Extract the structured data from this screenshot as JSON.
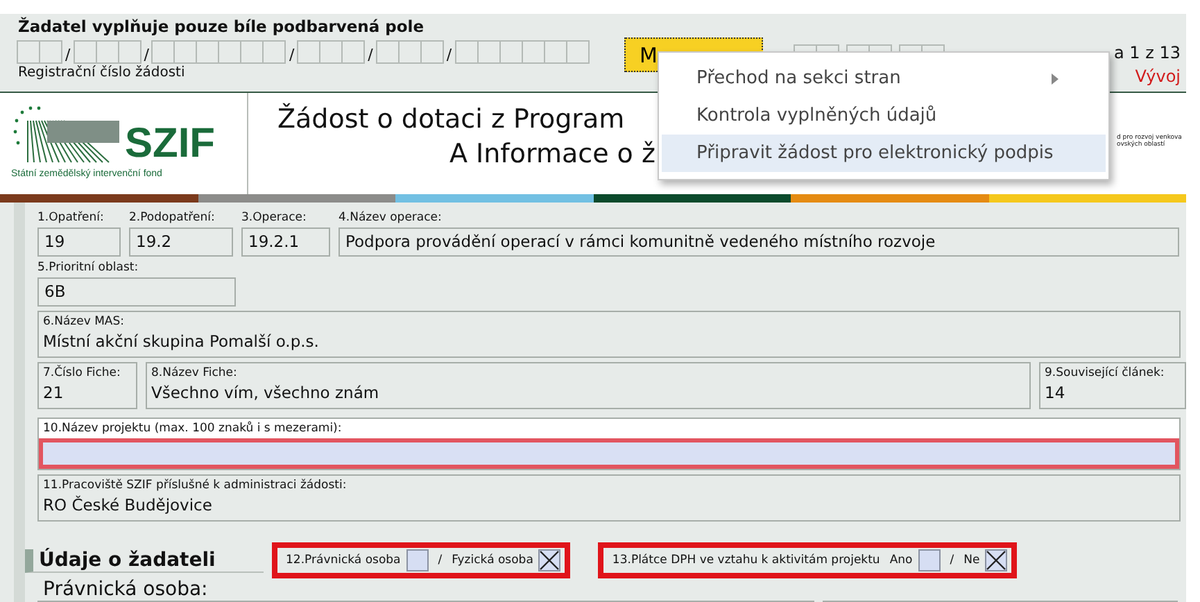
{
  "header": {
    "instruction": "Žadatel vyplňuje pouze bíle podbarvená pole",
    "registration_separators": [
      "/",
      "/",
      "/",
      "/",
      "/"
    ],
    "registration_label": "Registrační číslo žádosti",
    "menu_button": "M",
    "page_label": "a 1 z 13",
    "mode": "Vývoj"
  },
  "menu": {
    "items": [
      {
        "label": "Přechod na sekci stran",
        "submenu": true,
        "selected": false
      },
      {
        "label": "Kontrola vyplněných údajů",
        "submenu": false,
        "selected": false
      },
      {
        "label": "Připravit žádost pro elektronický podpis",
        "submenu": false,
        "selected": true
      }
    ]
  },
  "banner": {
    "logo_text": "SZIF",
    "logo_caption": "Státní zemědělský intervenční fond",
    "title_line1": "Žádost o dotaci z Program",
    "title_line2": "A Informace o ž",
    "eu_text": [
      "d pro rozvoj venkova",
      "ovských oblastí"
    ]
  },
  "rows": [
    [
      {
        "kind": "boxed",
        "label": "1.Opatření:",
        "value": "19"
      },
      {
        "kind": "boxed",
        "label": "2.Podopatření:",
        "value": "19.2"
      },
      {
        "kind": "boxed",
        "label": "3.Operace:",
        "value": "19.2.1"
      },
      {
        "kind": "boxed",
        "label": "4.Název operace:",
        "value": "Podpora provádění operací v rámci komunitně vedeného místního rozvoje"
      }
    ],
    [
      {
        "kind": "boxed",
        "label": "5.Prioritní oblast:",
        "value": "6B"
      }
    ],
    [
      {
        "kind": "framed",
        "label": "6.Název MAS:",
        "value": "Místní akční skupina Pomalší o.p.s."
      }
    ],
    [
      {
        "kind": "framed",
        "label": "7.Číslo Fiche:",
        "value": "21"
      },
      {
        "kind": "framed",
        "label": "8.Název Fiche:",
        "value": "Všechno vím, všechno znám"
      },
      {
        "kind": "framed",
        "label": "9.Související článek:",
        "value": "14"
      }
    ],
    [
      {
        "kind": "input",
        "label": "10.Název projektu (max. 100 znaků i s mezerami):"
      }
    ],
    [
      {
        "kind": "framed",
        "label": "11.Pracoviště SZIF příslušné k administraci žádosti:",
        "value": "RO České Budějovice"
      }
    ]
  ],
  "applicant": {
    "heading": "Údaje o žadateli",
    "questions": [
      {
        "separator": "/",
        "options": [
          {
            "label": "12.Právnická osoba",
            "checked": false
          },
          {
            "label": "Fyzická osoba",
            "checked": true
          }
        ]
      },
      {
        "label": "13.Plátce DPH ve vztahu k aktivitám projektu",
        "separator": "/",
        "options": [
          {
            "label": "Ano",
            "checked": false
          },
          {
            "label": "Ne",
            "checked": true
          }
        ]
      }
    ],
    "subheading": "Právnická osoba:"
  }
}
